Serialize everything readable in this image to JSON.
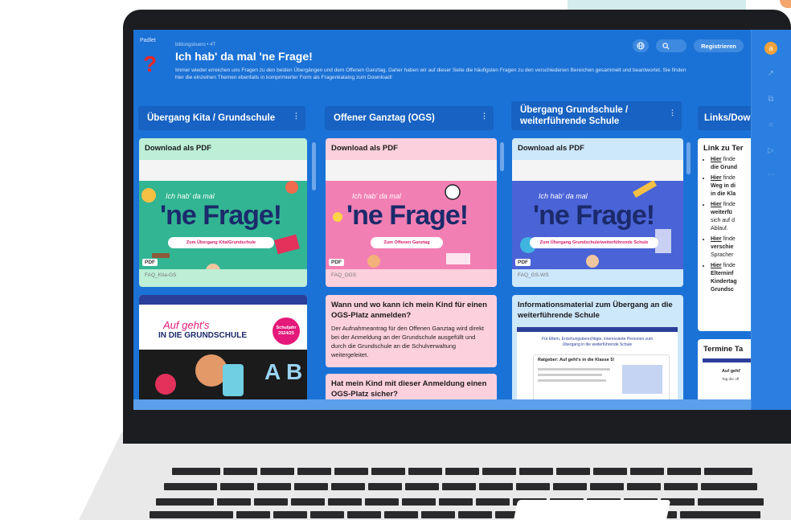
{
  "padlet": {
    "brand": "Padlet",
    "breadcrumb": "bildungsbuero • 4T",
    "title": "Ich hab' da mal 'ne Frage!",
    "description": "Immer wieder erreichen uns Fragen zu den beiden Übergängen und dem Offenen Ganztag. Daher haben wir auf dieser Seite die häufigsten Fragen zu den verschiedenen Bereichen gesammelt und beantwortet. Sie finden hier die einzelnen Themen ebenfalls in komprimierter Form als Fragenkatalog zum Download!",
    "register_label": "Registrieren",
    "avatar_letter": "a"
  },
  "columns": [
    {
      "heading": "Übergang Kita / Grundschule",
      "card1": {
        "title": "Download als PDF",
        "slogan": "Ich hab' da mal",
        "big": "'ne Frage!",
        "pill": "Zum Übergang Kita/Grundschule",
        "tag": "PDF",
        "file": "FAQ_Kita-GS",
        "bg": "#32b592"
      },
      "card2": {
        "banner_left": "Auf geht's",
        "banner_main": "IN DIE GRUNDSCHULE",
        "badge": "Schuljahr 2024/25",
        "letters": "A B"
      }
    },
    {
      "heading": "Offener Ganztag (OGS)",
      "card1": {
        "title": "Download als PDF",
        "slogan": "Ich hab' da mal",
        "big": "'ne Frage!",
        "pill": "Zum Offenen Ganztag",
        "tag": "PDF",
        "file": "FAQ_OGS",
        "bg": "#f27fb3"
      },
      "card2": {
        "title": "Wann und wo kann ich mein Kind für einen OGS-Platz anmelden?",
        "body": "Der Aufnahmeantrag für den Offenen Ganztag wird direkt bei der Anmeldung an der Grundschule ausgefüllt und durch die Grundschule an die Schulverwaltung weitergeleitet."
      },
      "card3": {
        "title": "Hat mein Kind mit dieser Anmeldung einen OGS-Platz sicher?"
      }
    },
    {
      "heading": "Übergang Grundschule / weiterführende Schule",
      "card1": {
        "title": "Download als PDF",
        "slogan": "Ich hab' da mal",
        "big": "'ne Frage!",
        "pill": "Zum Übergang Grundschule/weiterführende Schule",
        "tag": "PDF",
        "file": "FAQ_GS-WS",
        "bg": "#4a63d6"
      },
      "card2": {
        "title": "Informationsmaterial zum Übergang an die weiterführende Schule",
        "doc_head": "Für Eltern, Erziehungsberechtigte, interessierte Personen zum Übergang in die weiterführende Schule",
        "doc_sub": "Ratgeber: Auf geht's in die Klasse 5!"
      }
    },
    {
      "heading": "Links/Dow",
      "card1": {
        "title": "Link zu Ter",
        "items": [
          {
            "bold": "Hier",
            "rest": "finde",
            "line2": "die Grund"
          },
          {
            "bold": "Hier",
            "rest": "finde",
            "line2": "Weg in di",
            "line3": "in die Kla"
          },
          {
            "bold": "Hier",
            "rest": "finde",
            "line2": "weiterfü",
            "line3": "sich auf d",
            "line4": "Ablauf."
          },
          {
            "bold": "Hier",
            "rest": "finde",
            "line2": "verschie",
            "line3": "Spracher"
          },
          {
            "bold": "Hier",
            "rest": "finde",
            "line2": "Elterninf",
            "line3": "Kindertag",
            "line4": "Grundsc"
          }
        ]
      },
      "card2": {
        "title": "Termine Ta",
        "sub1": "Auf geht'",
        "sub2": "Tag der off"
      }
    }
  ]
}
